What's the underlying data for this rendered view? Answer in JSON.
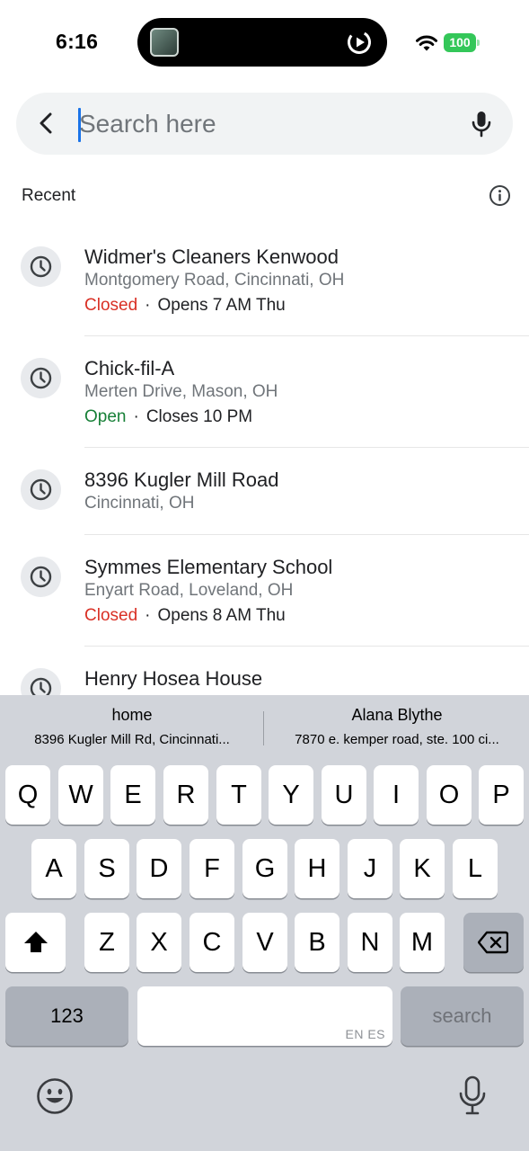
{
  "status_bar": {
    "time": "6:16",
    "battery": "100",
    "battery_color": "#34c759"
  },
  "search": {
    "placeholder": "Search here",
    "value": "",
    "back_icon": "chevron-left-icon",
    "mic_icon": "microphone-icon"
  },
  "recent": {
    "header": "Recent",
    "info_icon": "info-icon",
    "items": [
      {
        "title": "Widmer's Cleaners Kenwood",
        "subtitle": "Montgomery Road, Cincinnati, OH",
        "status": "Closed",
        "status_type": "closed",
        "hours": "Opens 7 AM Thu",
        "icon": "clock-icon"
      },
      {
        "title": "Chick-fil-A",
        "subtitle": "Merten Drive, Mason, OH",
        "status": "Open",
        "status_type": "open",
        "hours": "Closes 10 PM",
        "icon": "clock-icon"
      },
      {
        "title": "8396 Kugler Mill Road",
        "subtitle": "Cincinnati, OH",
        "icon": "clock-icon"
      },
      {
        "title": "Symmes Elementary School",
        "subtitle": "Enyart Road, Loveland, OH",
        "status": "Closed",
        "status_type": "closed",
        "hours": "Opens 8 AM Thu",
        "icon": "clock-icon"
      },
      {
        "title": "Henry Hosea House",
        "icon": "clock-icon"
      }
    ]
  },
  "colors": {
    "closed": "#d93025",
    "open": "#188038",
    "accent": "#1a73e8"
  },
  "keyboard": {
    "suggestions": [
      {
        "title": "home",
        "subtitle": "8396 Kugler Mill Rd, Cincinnati..."
      },
      {
        "title": "Alana Blythe",
        "subtitle": "7870 e. kemper road, ste. 100 ci..."
      }
    ],
    "row1": [
      "Q",
      "W",
      "E",
      "R",
      "T",
      "Y",
      "U",
      "I",
      "O",
      "P"
    ],
    "row2": [
      "A",
      "S",
      "D",
      "F",
      "G",
      "H",
      "J",
      "K",
      "L"
    ],
    "row3": [
      "Z",
      "X",
      "C",
      "V",
      "B",
      "N",
      "M"
    ],
    "numbers_label": "123",
    "space_hint": "EN ES",
    "search_label": "search",
    "shift_icon": "shift-icon",
    "delete_icon": "delete-backspace-icon",
    "emoji_icon": "emoji-icon",
    "dictation_icon": "dictation-microphone-icon"
  }
}
